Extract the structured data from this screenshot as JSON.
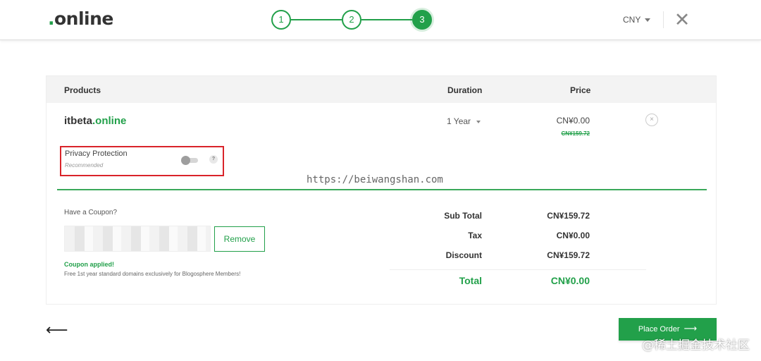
{
  "header": {
    "logo_dot": ".",
    "logo_word": "online",
    "steps": [
      "1",
      "2",
      "3"
    ],
    "active_step": 3,
    "currency": "CNY",
    "close_glyph": "✕"
  },
  "table": {
    "col_products": "Products",
    "col_duration": "Duration",
    "col_price": "Price"
  },
  "item": {
    "domain_name": "itbeta",
    "domain_tld": ".online",
    "duration": "1 Year",
    "price": "CN¥0.00",
    "price_original": "CN¥159.72",
    "remove_glyph": "×"
  },
  "privacy": {
    "label": "Privacy Protection",
    "sublabel": "Recommended",
    "enabled": false,
    "help": "?"
  },
  "watermark_url": "https://beiwangshan.com",
  "coupon": {
    "title": "Have a Coupon?",
    "remove_label": "Remove",
    "applied": "Coupon applied!",
    "note": "Free 1st year standard domains exclusively for Blogosphere Members!"
  },
  "summary": {
    "subtotal_label": "Sub Total",
    "subtotal_value": "CN¥159.72",
    "tax_label": "Tax",
    "tax_value": "CN¥0.00",
    "discount_label": "Discount",
    "discount_value": "CN¥159.72",
    "total_label": "Total",
    "total_value": "CN¥0.00"
  },
  "footer": {
    "back_glyph": "⟵",
    "place_order": "Place Order",
    "place_order_arrow": "⟶"
  },
  "site_watermark": "@稀土掘金技术社区",
  "colors": {
    "brand_green": "#22a04a",
    "highlight_red": "#d9242a"
  }
}
